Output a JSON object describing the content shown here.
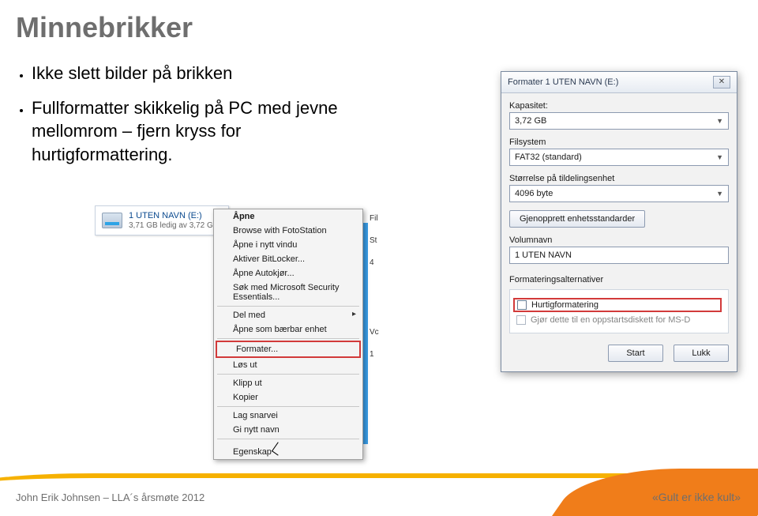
{
  "title": "Minnebrikker",
  "bullets": [
    "Ikke slett bilder på brikken",
    "Fullformatter skikkelig på PC med jevne mellomrom – fjern kryss for hurtigformattering."
  ],
  "drive": {
    "name": "1 UTEN NAVN (E:)",
    "sub": "3,71 GB ledig av 3,72 G"
  },
  "trunc": {
    "a": "Fil",
    "b": "St",
    "c": "4",
    "d": "Vc",
    "e": "1"
  },
  "blue_strip": "",
  "context_menu": {
    "open": "Åpne",
    "browse": "Browse with FotoStation",
    "new_window": "Åpne i nytt vindu",
    "bitlocker": "Aktiver BitLocker...",
    "autokjor": "Åpne Autokjør...",
    "mse": "Søk med Microsoft Security Essentials...",
    "share": "Del med",
    "portable": "Åpne som bærbar enhet",
    "format": "Formater...",
    "eject": "Løs ut",
    "cut": "Klipp ut",
    "copy": "Kopier",
    "shortcut": "Lag snarvei",
    "rename": "Gi nytt navn",
    "properties": "Egenskap"
  },
  "dialog": {
    "title": "Formater 1 UTEN NAVN (E:)",
    "close": "✕",
    "capacity_label": "Kapasitet:",
    "capacity_value": "3,72 GB",
    "filesystem_label": "Filsystem",
    "filesystem_value": "FAT32 (standard)",
    "alloc_label": "Størrelse på tildelingsenhet",
    "alloc_value": "4096 byte",
    "restore": "Gjenopprett enhetsstandarder",
    "volname_label": "Volumnavn",
    "volname_value": "1 UTEN NAVN",
    "options_label": "Formateringsalternativer",
    "quick": "Hurtigformatering",
    "msdos": "Gjør dette til en oppstartsdiskett for MS-D",
    "start": "Start",
    "close_btn": "Lukk"
  },
  "footer": {
    "left": "John Erik Johnsen – LLA´s årsmøte 2012",
    "right": "«Gult er ikke kult»"
  }
}
